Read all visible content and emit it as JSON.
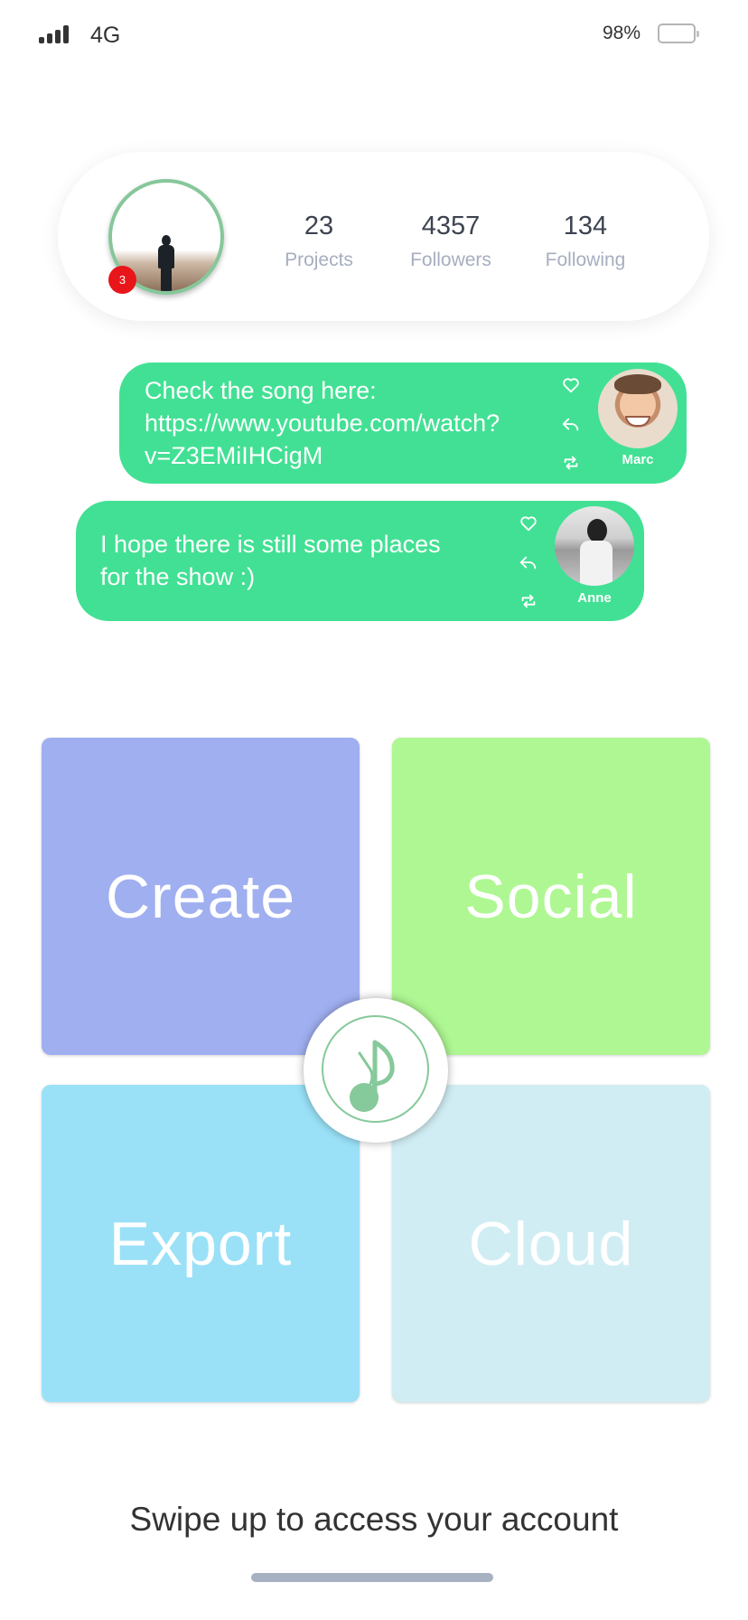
{
  "status_bar": {
    "network": "4G",
    "battery_percent": "98%",
    "signal_icon": "signal-bars-icon",
    "battery_icon": "battery-icon"
  },
  "profile": {
    "notification_count": "3",
    "ring_color": "#86c79a",
    "badge_color": "#e8161a",
    "stats": [
      {
        "value": "23",
        "label": "Projects"
      },
      {
        "value": "4357",
        "label": "Followers"
      },
      {
        "value": "134",
        "label": "Following"
      }
    ]
  },
  "messages": [
    {
      "text_lines": [
        "Check the song here:",
        "https://www.youtube.com/watch?",
        "v=Z3EMiIHCigM"
      ],
      "author": "Marc",
      "actions": [
        "heart-icon",
        "reply-icon",
        "repeat-icon"
      ]
    },
    {
      "text_lines": [
        "I hope there is still some places",
        "for the show :)"
      ],
      "author": "Anne",
      "actions": [
        "heart-icon",
        "reply-icon",
        "repeat-icon"
      ]
    }
  ],
  "bubble_color": "#42e094",
  "tiles": [
    {
      "label": "Create",
      "color": "#a0aff0"
    },
    {
      "label": "Social",
      "color": "#aff793"
    },
    {
      "label": "Export",
      "color": "#9ae1f7"
    },
    {
      "label": "Cloud",
      "color": "#d1edf4"
    }
  ],
  "hub": {
    "icon": "music-note-logo-icon",
    "color": "#86c99a"
  },
  "footer": {
    "swipe_text": "Swipe up to access your account"
  }
}
